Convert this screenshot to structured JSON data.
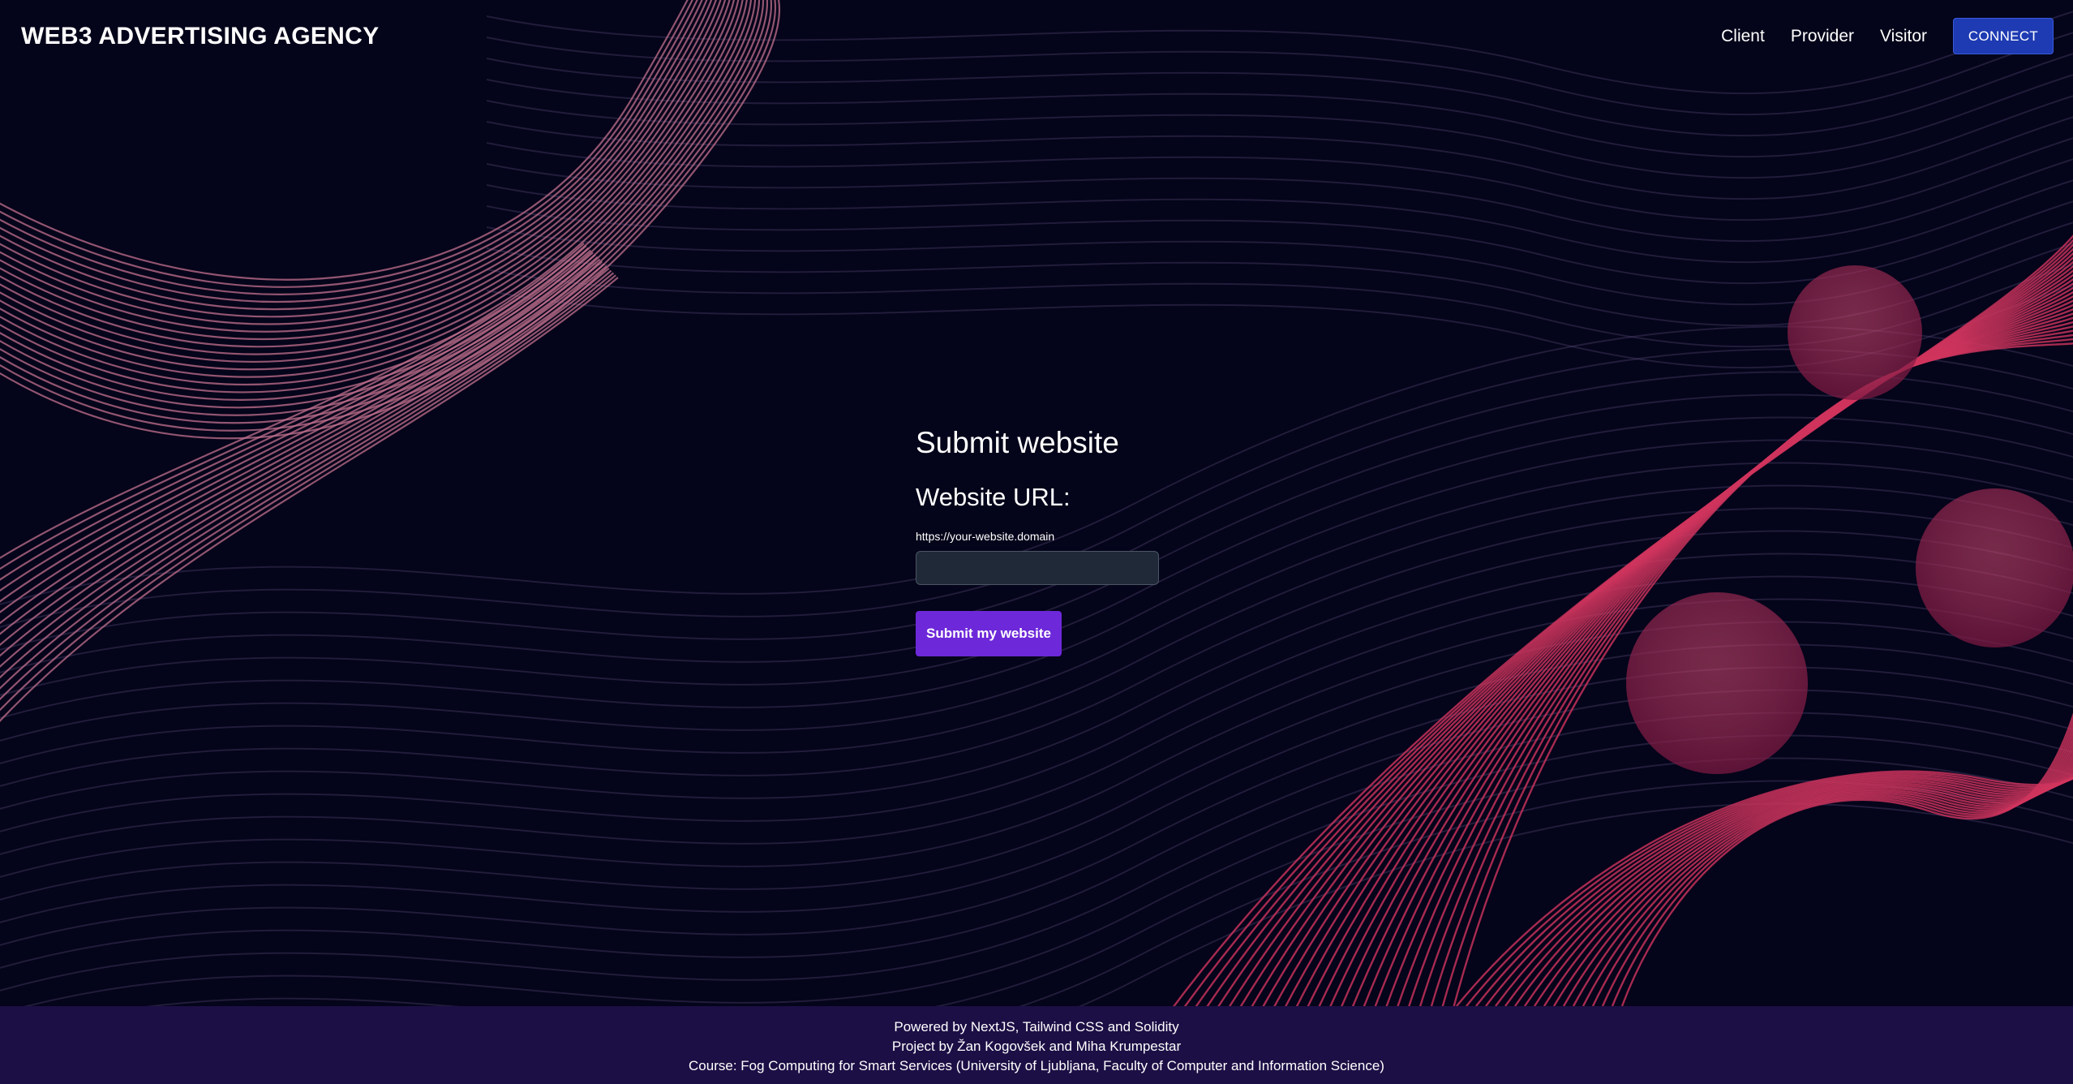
{
  "header": {
    "brand": "WEB3 ADVERTISING AGENCY",
    "nav": [
      {
        "label": "Client"
      },
      {
        "label": "Provider"
      },
      {
        "label": "Visitor"
      }
    ],
    "connect_label": "CONNECT"
  },
  "main": {
    "title": "Submit website",
    "url_label": "Website URL:",
    "url_hint": "https://your-website.domain",
    "url_value": "",
    "submit_label": "Submit my website"
  },
  "footer": {
    "lines": [
      "Powered by NextJS, Tailwind CSS and Solidity",
      "Project by Žan Kogovšek and Miha Krumpestar",
      "Course: Fog Computing for Smart Services (University of Ljubljana, Faculty of Computer and Information Science)"
    ]
  },
  "colors": {
    "background": "#04041a",
    "line_pink": "#c2708e",
    "line_red": "#d0355e",
    "connect_button": "#1e3bb3",
    "submit_button": "#6d28d9",
    "input_bg": "#1f2937",
    "footer_bg": "#1c0f45"
  }
}
